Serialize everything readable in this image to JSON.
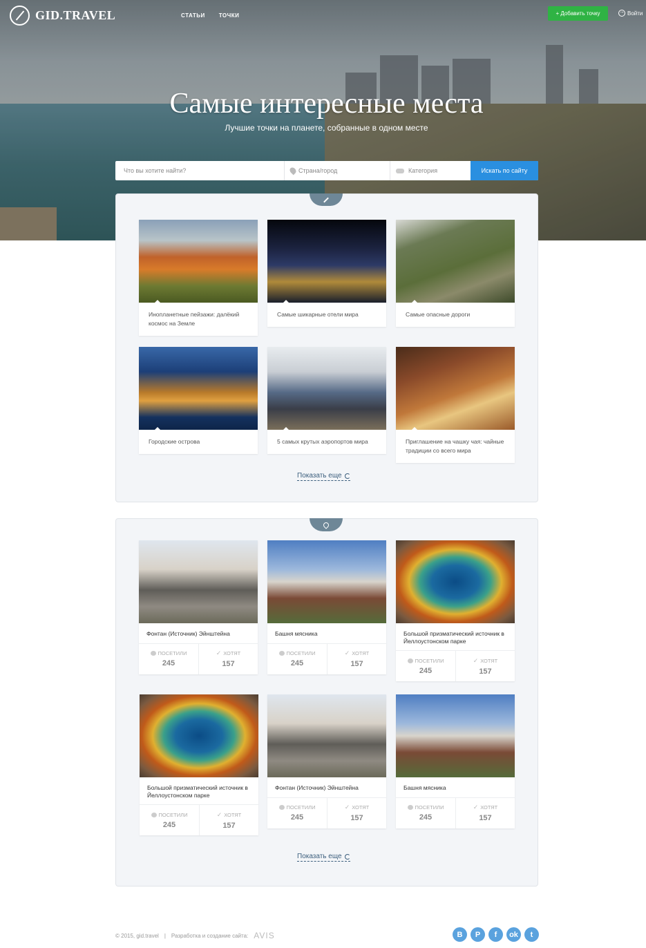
{
  "header": {
    "logo": "GID.TRAVEL",
    "nav": [
      "статьи",
      "точки"
    ],
    "add_button": "+ Добавить точку",
    "login": "Войти"
  },
  "hero": {
    "title": "Самые интересные места",
    "subtitle": "Лучшие точки на планете, собранные в одном месте"
  },
  "search": {
    "query_placeholder": "Что вы хотите найти?",
    "location_placeholder": "Страна/город",
    "category_placeholder": "Категория",
    "submit": "Искать по сайту"
  },
  "articles": [
    {
      "caption": "Инопланетные пейзажи: далёкий космос на Земле",
      "image": "geyser-landscape"
    },
    {
      "caption": "Самые шикарные отели мира",
      "image": "marina-bay-hotel"
    },
    {
      "caption": "Самые опасные дороги",
      "image": "mountain-serpentine-road"
    },
    {
      "caption": "Городские острова",
      "image": "manhattan-night-aerial"
    },
    {
      "caption": "5 самых крутых аэропортов мира",
      "image": "airport-terminal"
    },
    {
      "caption": "Приглашение на чашку чая: чайные традиции со всего мира",
      "image": "tea-set"
    }
  ],
  "show_more": "Показать еще",
  "points": [
    {
      "title": "Фонтан (Источник) Эйнштейна",
      "image": "einstein-fountain",
      "visited_label": "Посетили",
      "visited": "245",
      "want_label": "Хотят",
      "want": "157"
    },
    {
      "title": "Башня мясника",
      "image": "butcher-tower",
      "visited_label": "Посетили",
      "visited": "245",
      "want_label": "Хотят",
      "want": "157"
    },
    {
      "title": "Большой призматический источник в Йеллоустонском парке",
      "image": "grand-prismatic-spring",
      "visited_label": "Посетили",
      "visited": "245",
      "want_label": "Хотят",
      "want": "157"
    },
    {
      "title": "Большой призматический источник в Йеллоустонском парке",
      "image": "grand-prismatic-spring",
      "visited_label": "Посетили",
      "visited": "245",
      "want_label": "Хотят",
      "want": "157"
    },
    {
      "title": "Фонтан (Источник) Эйнштейна",
      "image": "einstein-fountain",
      "visited_label": "Посетили",
      "visited": "245",
      "want_label": "Хотят",
      "want": "157"
    },
    {
      "title": "Башня мясника",
      "image": "butcher-tower",
      "visited_label": "Посетили",
      "visited": "245",
      "want_label": "Хотят",
      "want": "157"
    }
  ],
  "footer": {
    "copyright": "© 2015, gid.travel",
    "separator": "|",
    "dev": "Разработка и создание сайта:",
    "dev_brand": "AVIS",
    "social": [
      "В",
      "P",
      "f",
      "ok",
      "t"
    ]
  },
  "colors": {
    "accent_blue": "#2a8fe0",
    "green": "#2fb344",
    "link": "#3a5d7c",
    "tab": "#6e8797",
    "social": "#5aa2de"
  }
}
